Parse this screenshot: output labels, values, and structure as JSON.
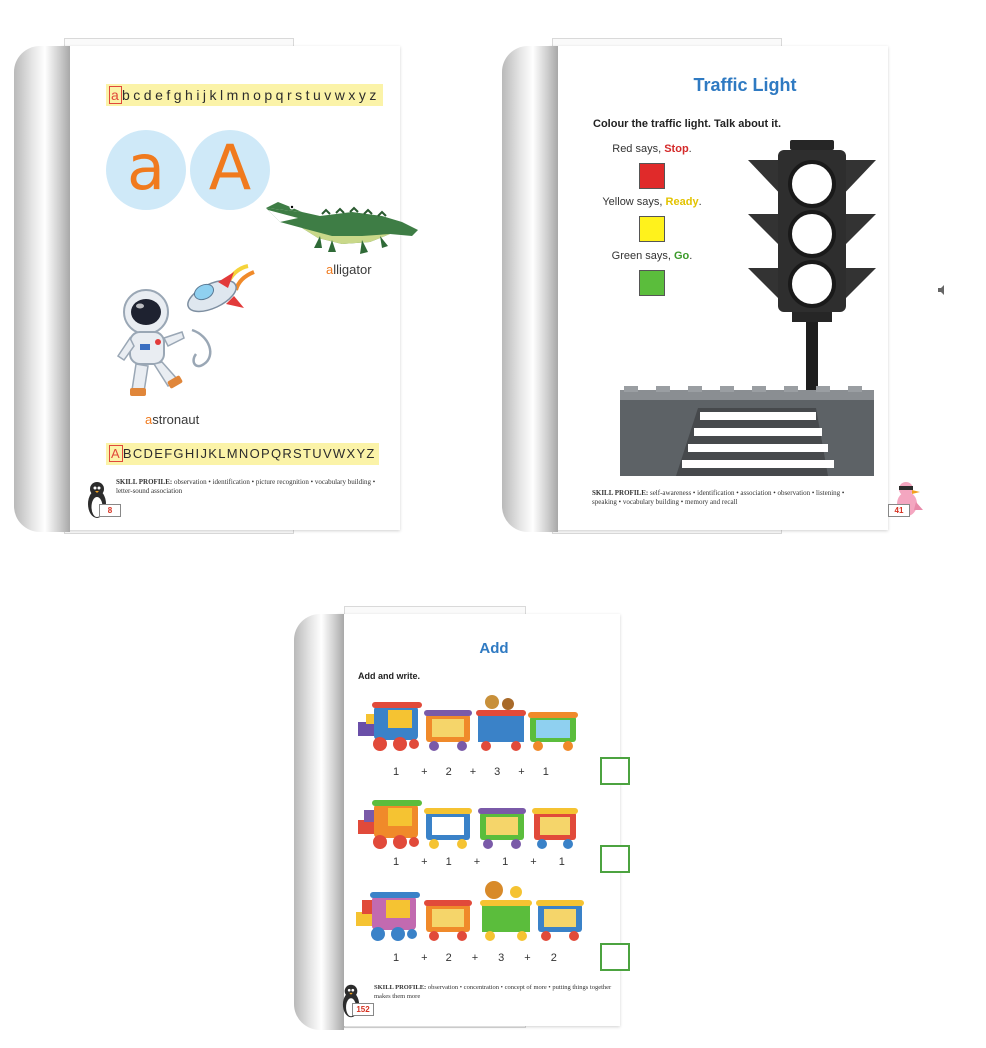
{
  "book1": {
    "lower_alphabet_first": "a",
    "lower_alphabet_rest": "bcdefghijklmnopqrstuvwxyz",
    "upper_alphabet_first": "A",
    "upper_alphabet_rest": "BCDEFGHIJKLMNOPQRSTUVWXYZ",
    "big_lower": "a",
    "big_upper": "A",
    "alligator_first": "a",
    "alligator_rest": "lligator",
    "astronaut_first": "a",
    "astronaut_rest": "stronaut",
    "skill_label": "SKILL PROFILE:",
    "skill_text": "observation • identification • picture recognition • vocabulary building • letter-sound association",
    "page_number": "8"
  },
  "book2": {
    "title": "Traffic Light",
    "instruction": "Colour the traffic light. Talk about it.",
    "rows": [
      {
        "prefix": "Red says, ",
        "word": "Stop",
        "suffix": ".",
        "color": "#e02a2a",
        "word_color": "#d42a2a"
      },
      {
        "prefix": "Yellow says, ",
        "word": "Ready",
        "suffix": ".",
        "color": "#fff21c",
        "word_color": "#e3c300"
      },
      {
        "prefix": "Green says, ",
        "word": "Go",
        "suffix": ".",
        "color": "#5bbd3c",
        "word_color": "#3c9a2a"
      }
    ],
    "skill_label": "SKILL PROFILE:",
    "skill_text": "self-awareness • identification • association • observation • listening • speaking • vocabulary building • memory and recall",
    "page_number": "41"
  },
  "book3": {
    "title": "Add",
    "instruction": "Add and write.",
    "sums": [
      [
        "1",
        "+",
        "2",
        "+",
        "3",
        "+",
        "1"
      ],
      [
        "1",
        "+",
        "1",
        "+",
        "1",
        "+",
        "1"
      ],
      [
        "1",
        "+",
        "2",
        "+",
        "3",
        "+",
        "2"
      ]
    ],
    "skill_label": "SKILL PROFILE:",
    "skill_text": "observation • concentration • concept of more • putting things together makes them more",
    "page_number": "152"
  },
  "colors": {
    "title_blue": "#2f7ac2",
    "accent_orange": "#f07a1e",
    "answer_box_green": "#4ca340",
    "alphabet_strip": "#fbf3a8"
  }
}
